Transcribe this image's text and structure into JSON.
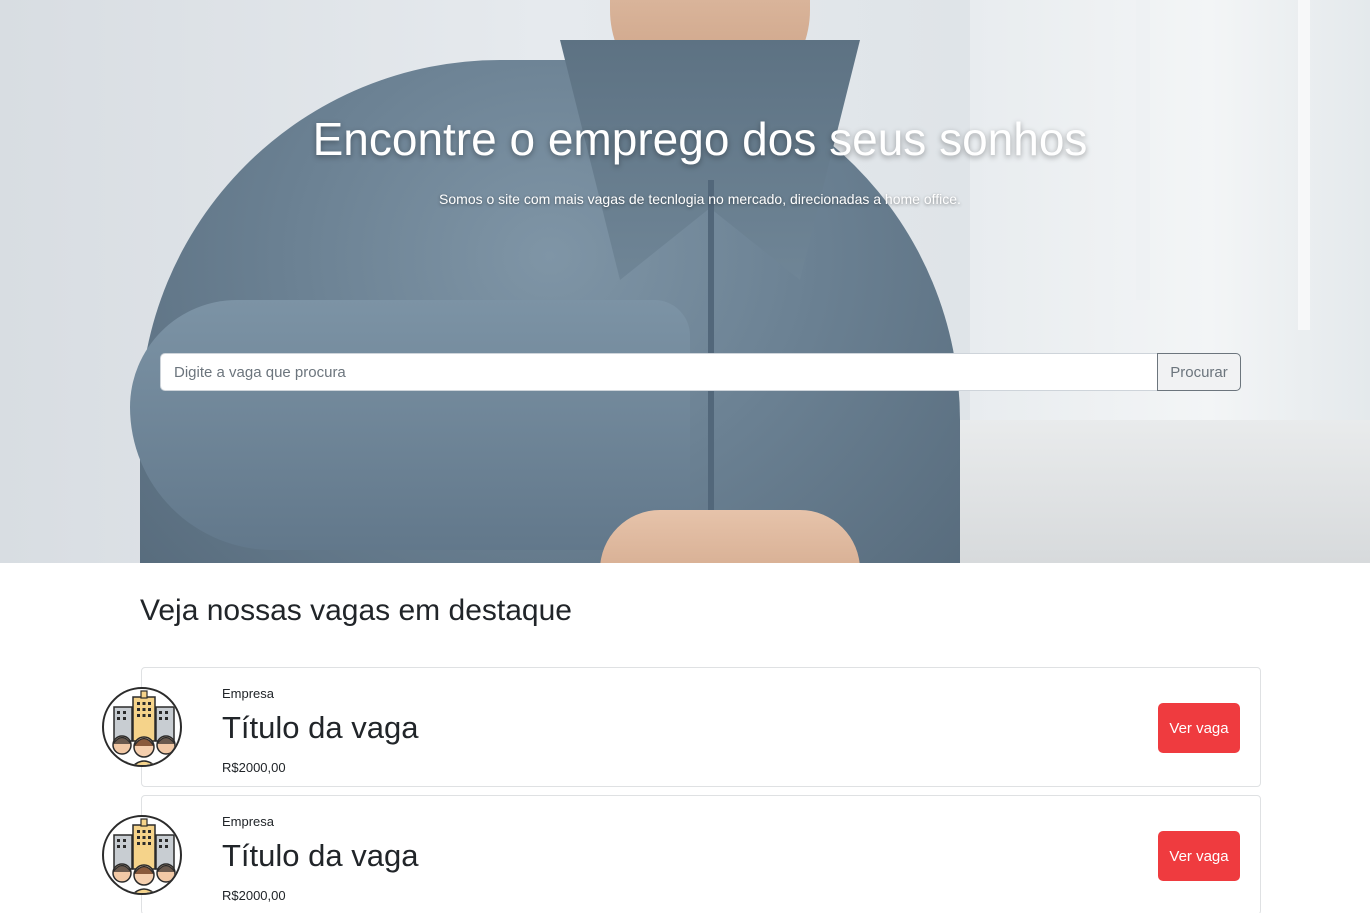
{
  "hero": {
    "title": "Encontre o emprego dos seus sonhos",
    "subtitle": "Somos o site com mais vagas de tecnlogia no mercado, direcionadas a home office."
  },
  "search": {
    "placeholder": "Digite a vaga que procura",
    "value": "",
    "button_label": "Procurar"
  },
  "featured": {
    "title": "Veja nossas vagas em destaque",
    "jobs": [
      {
        "company": "Empresa",
        "title": "Título da vaga",
        "salary": "R$2000,00",
        "button_label": "Ver vaga",
        "icon": "company-team-icon"
      },
      {
        "company": "Empresa",
        "title": "Título da vaga",
        "salary": "R$2000,00",
        "button_label": "Ver vaga",
        "icon": "company-team-icon"
      }
    ]
  },
  "colors": {
    "accent": "#ef3b3f",
    "text": "#212529",
    "border": "#dfe1e3"
  }
}
